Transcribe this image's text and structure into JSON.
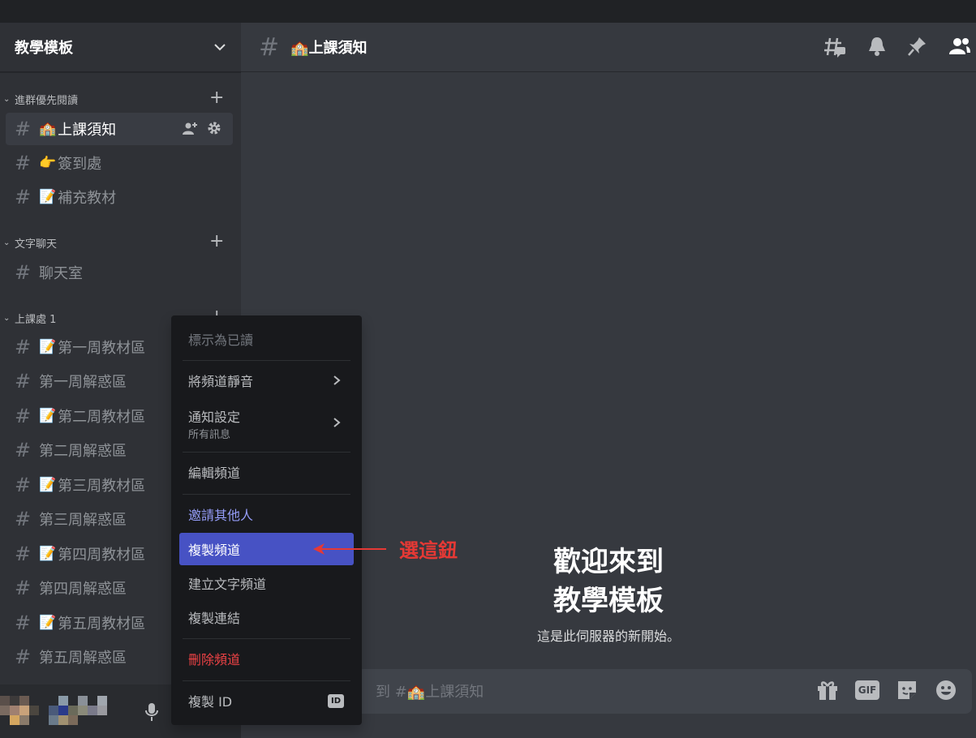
{
  "server": {
    "name": "教學模板"
  },
  "categories": [
    {
      "name": "進群優先閱讀"
    },
    {
      "name": "文字聊天"
    },
    {
      "name": "上課處 1"
    }
  ],
  "channels": [
    {
      "emoji": "🏫",
      "name": "上課須知"
    },
    {
      "emoji": "👉",
      "name": "簽到處"
    },
    {
      "emoji": "📝",
      "name": "補充教材"
    },
    {
      "emoji": "",
      "name": "聊天室"
    },
    {
      "emoji": "📝",
      "name": "第一周教材區"
    },
    {
      "emoji": "",
      "name": "第一周解惑區"
    },
    {
      "emoji": "📝",
      "name": "第二周教材區"
    },
    {
      "emoji": "",
      "name": "第二周解惑區"
    },
    {
      "emoji": "📝",
      "name": "第三周教材區"
    },
    {
      "emoji": "",
      "name": "第三周解惑區"
    },
    {
      "emoji": "📝",
      "name": "第四周教材區"
    },
    {
      "emoji": "",
      "name": "第四周解惑區"
    },
    {
      "emoji": "📝",
      "name": "第五周教材區"
    },
    {
      "emoji": "",
      "name": "第五周解惑區"
    }
  ],
  "header": {
    "channel_emoji": "🏫",
    "channel_name": "上課須知"
  },
  "welcome": {
    "line1": "歡迎來到",
    "line2": "教學模板",
    "subtitle": "這是此伺服器的新開始。"
  },
  "composer": {
    "placeholder_visible": "到 #",
    "channel_emoji": "🏫",
    "channel_name": "上課須知",
    "gif_label": "GIF"
  },
  "context_menu": {
    "mark_read": "標示為已讀",
    "mute": "將頻道靜音",
    "notify": "通知設定",
    "notify_sub": "所有訊息",
    "edit": "編輯頻道",
    "invite": "邀請其他人",
    "clone": "複製頻道",
    "create_text": "建立文字頻道",
    "copy_link": "複製連結",
    "delete": "刪除頻道",
    "copy_id": "複製 ID",
    "id_badge": "ID"
  },
  "annotation": {
    "text": "選這鈕",
    "color": "#e53935"
  },
  "colors": {
    "accent": "#4752c4",
    "danger": "#ed4245",
    "link": "#949cf7"
  }
}
